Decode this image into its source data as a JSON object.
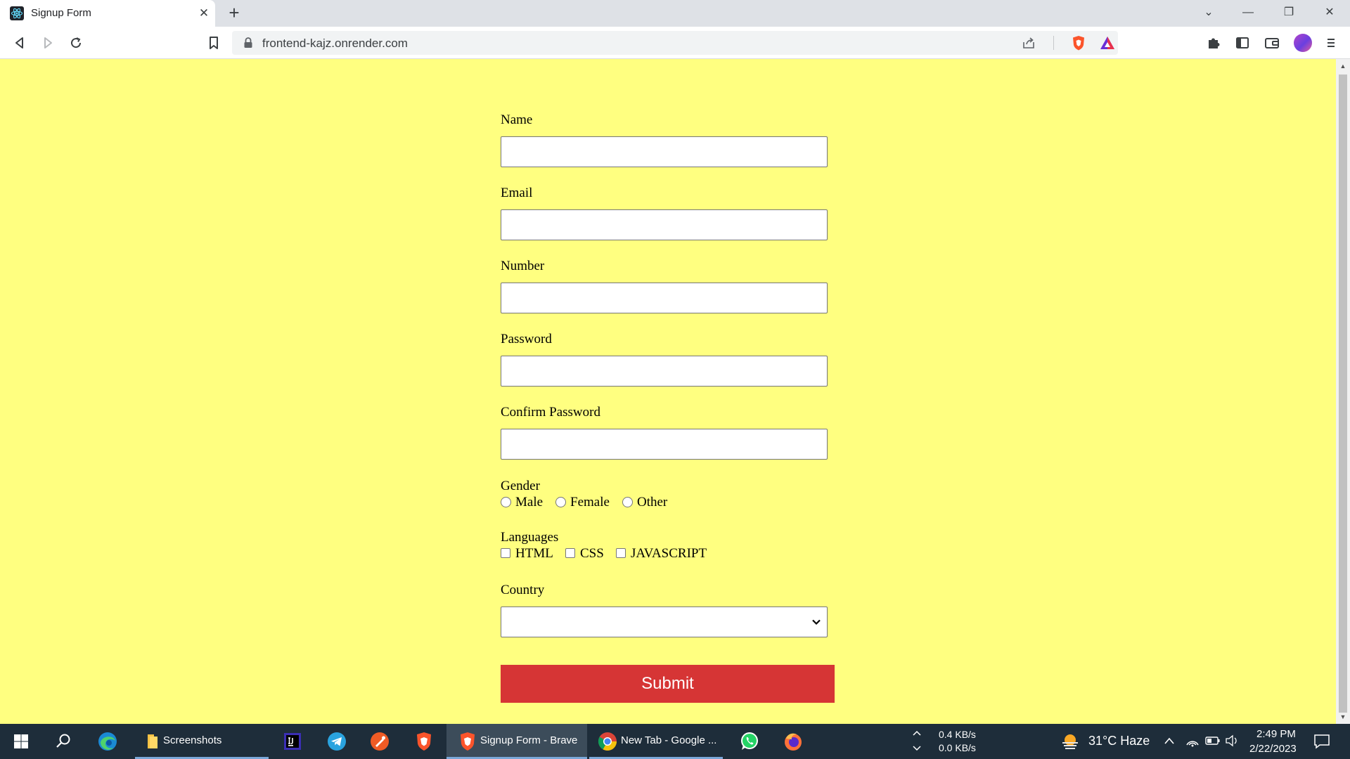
{
  "browser": {
    "tab_title": "Signup Form",
    "tab_close": "✕",
    "new_tab": "+",
    "url": "frontend-kajz.onrender.com"
  },
  "window_controls": {
    "tab_list": "⌄",
    "minimize": "—",
    "restore": "❐",
    "close": "✕"
  },
  "form": {
    "name_label": "Name",
    "email_label": "Email",
    "number_label": "Number",
    "password_label": "Password",
    "confirm_password_label": "Confirm Password",
    "gender_label": "Gender",
    "gender_options": [
      "Male",
      "Female",
      "Other"
    ],
    "languages_label": "Languages",
    "language_options": [
      "HTML",
      "CSS",
      "JAVASCRIPT"
    ],
    "country_label": "Country",
    "country_value": "",
    "submit_label": "Submit"
  },
  "taskbar": {
    "items": [
      {
        "label": "Screenshots"
      },
      {
        "label": "Signup Form - Brave"
      },
      {
        "label": "New Tab - Google ..."
      }
    ],
    "net_up": "0.4 KB/s",
    "net_down": "0.0 KB/s",
    "weather": "31°C  Haze",
    "time": "2:49 PM",
    "date": "2/22/2023"
  },
  "colors": {
    "page_background": "#ffff80",
    "submit_background": "#d63535",
    "taskbar": "#1e2d3a"
  }
}
